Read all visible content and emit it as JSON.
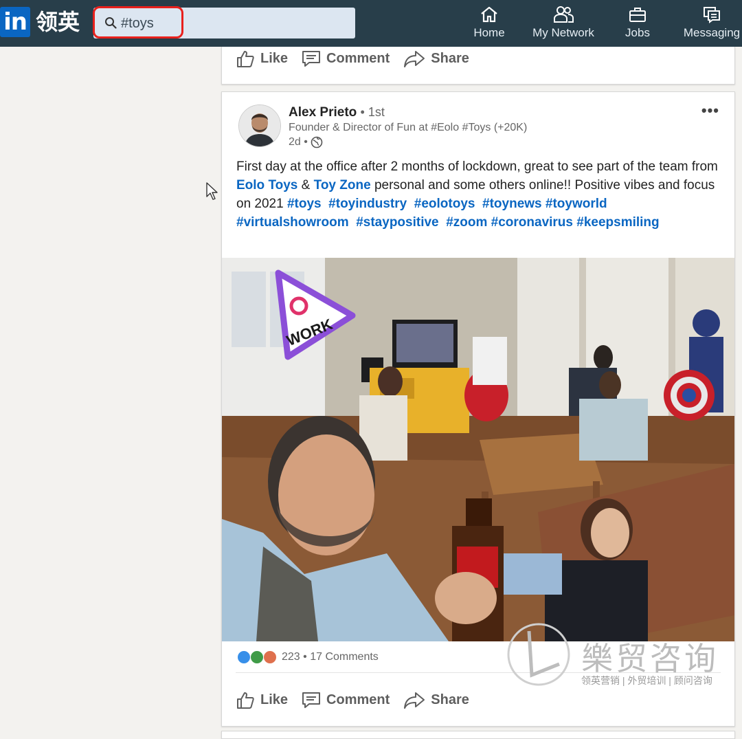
{
  "header": {
    "logo_mark": "in",
    "logo_text": "领英",
    "search": {
      "value": "#toys"
    },
    "nav": [
      {
        "label": "Home",
        "icon": "home-icon"
      },
      {
        "label": "My Network",
        "icon": "network-icon"
      },
      {
        "label": "Jobs",
        "icon": "briefcase-icon"
      },
      {
        "label": "Messaging",
        "icon": "messaging-icon"
      }
    ]
  },
  "prev_post": {
    "actions": {
      "like": "Like",
      "comment": "Comment",
      "share": "Share"
    }
  },
  "post": {
    "author": "Alex Prieto",
    "degree": "• 1st",
    "headline": "Founder & Director of Fun at #Eolo #Toys (+20K)",
    "time": "2d •",
    "text": {
      "p1": "First day at the office after 2 months of lockdown, great to see part of the team from ",
      "mention1": "Eolo Toys",
      "p2": " & ",
      "mention2": "Toy Zone",
      "p3": " personal and some others online!! Positive vibes and focus on 2021 ",
      "hashtags": [
        "#toys",
        "#toyindustry",
        "#eolotoys",
        "#toynews",
        "#toyworld",
        "#virtualshowroom",
        "#staypositive",
        "#zoom",
        "#coronavirus",
        "#keepsmiling"
      ]
    },
    "photo_sticker": {
      "line1": "@",
      "line2": "WORK"
    },
    "reactions_count": "223",
    "comments_count": "• 17 Comments",
    "actions": {
      "like": "Like",
      "comment": "Comment",
      "share": "Share"
    }
  },
  "watermark": {
    "title": "樂贸咨询",
    "subtitle": "领英营销 | 外贸培训 | 顾问咨询"
  },
  "colors": {
    "topbar": "#283e4a",
    "link": "#0a66c2",
    "search_highlight": "#e8201c"
  }
}
